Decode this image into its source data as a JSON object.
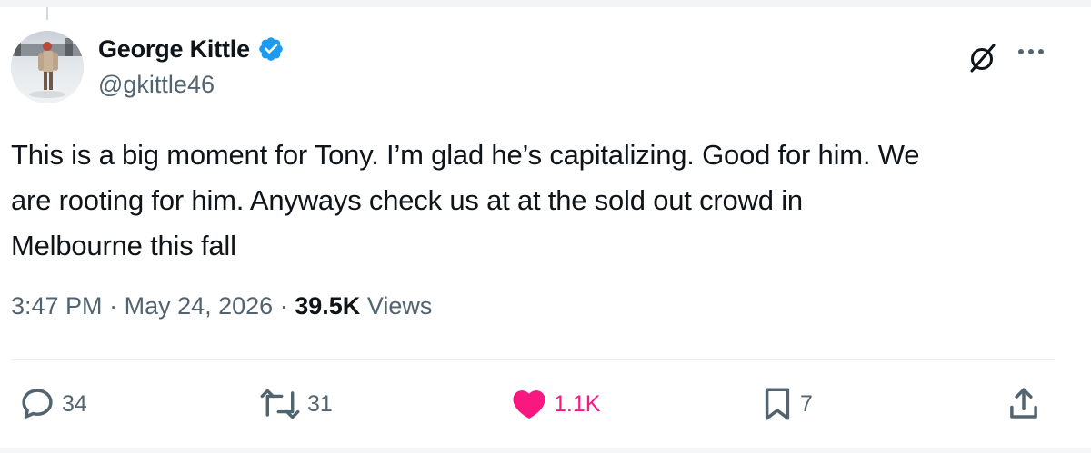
{
  "tweet": {
    "author": {
      "display_name": "George Kittle",
      "handle": "@gkittle46",
      "verified": true
    },
    "text_lines": [
      "This is a big moment for Tony. I’m glad he’s capitalizing. Good for him. We",
      "are rooting for him. Anyways check us at at the sold out crowd in",
      "Melbourne this fall"
    ],
    "time": "3:47 PM",
    "date": "May 24, 2026",
    "separator": "·",
    "views_count": "39.5K",
    "views_label": "Views"
  },
  "actions": {
    "replies": "34",
    "reposts": "31",
    "likes": "1.1K",
    "bookmarks": "7"
  },
  "colors": {
    "verified": "#1d9bf0",
    "like": "#f91880",
    "secondary_text": "#536471",
    "primary_text": "#0f1419"
  },
  "icons": [
    "verified-badge-icon",
    "grok-icon",
    "more-icon",
    "reply-icon",
    "repost-icon",
    "like-icon",
    "bookmark-icon",
    "share-icon"
  ]
}
